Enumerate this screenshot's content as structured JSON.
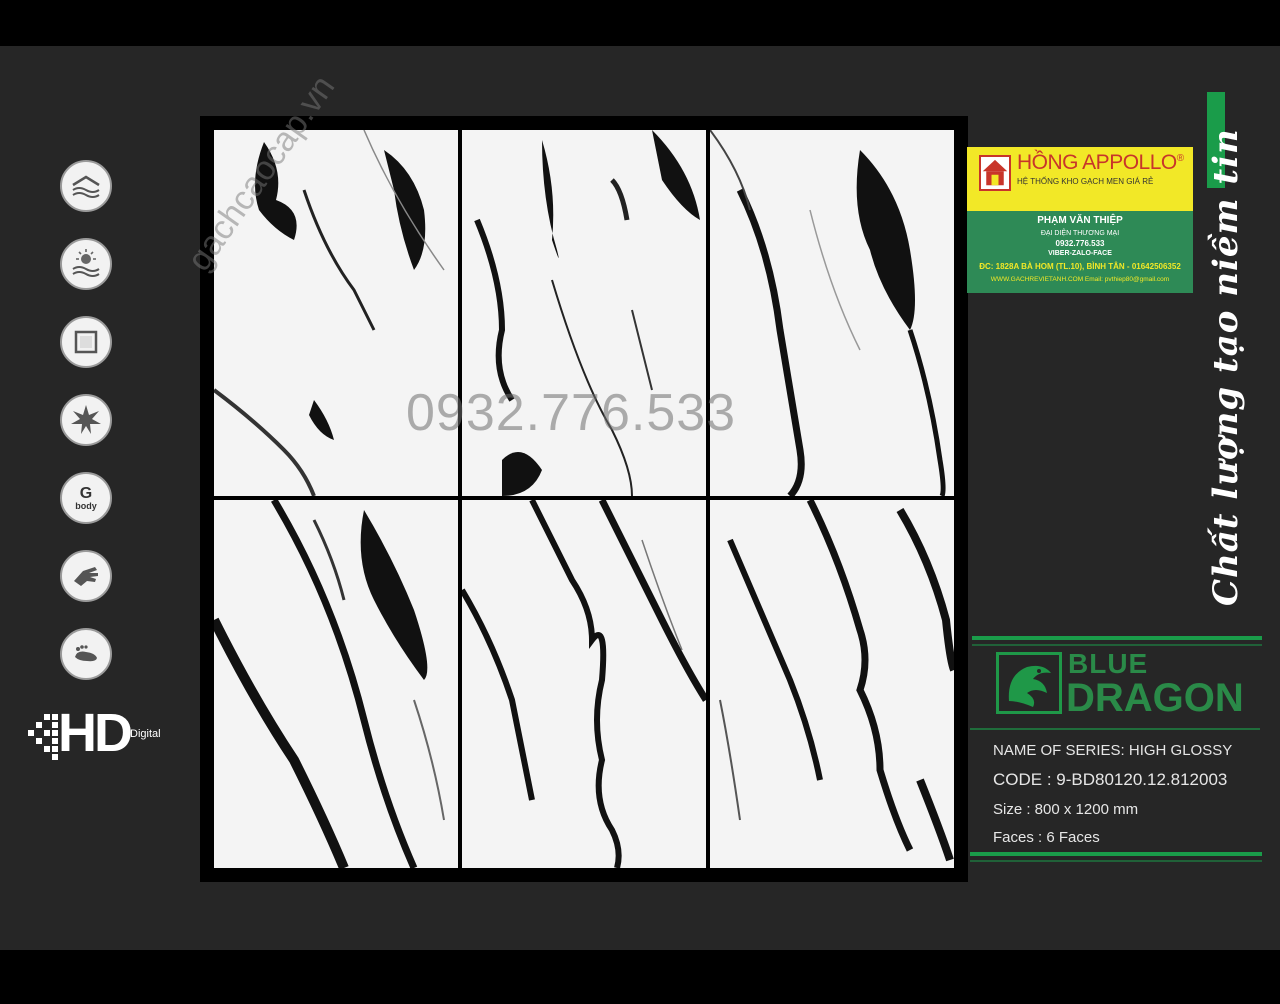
{
  "features": {
    "icons": [
      "wave-roof-icon",
      "sun-water-icon",
      "square-edge-icon",
      "starburst-icon",
      "g-body-icon",
      "hand-icon",
      "foot-icon"
    ],
    "g_body_letter": "G",
    "g_body_word": "body"
  },
  "hd": {
    "big": "HD",
    "small": "Digital"
  },
  "watermark": {
    "phone": "0932.776.533",
    "site": "gachcaocap.vn"
  },
  "card": {
    "brand": "HỒNG APPOLLO",
    "reg": "®",
    "tagline": "HỆ THỐNG KHO GẠCH MEN GIÁ RẺ",
    "name": "PHẠM VĂN THIỆP",
    "role": "ĐẠI DIỆN THƯƠNG MẠI",
    "phone": "0932.776.533",
    "contact": "VIBER-ZALO-FACE",
    "address": "ĐC: 1828A BÀ HOM (TL.10), BÌNH TÂN - 01642506352",
    "web": "WWW.GACHREVIETANH.COM  Email: pvthiep80@gmail.com"
  },
  "slogan": "Chất lượng tạo niềm tin",
  "brand": {
    "line1": "BLUE",
    "line2": "DRAGON"
  },
  "specs": {
    "series": "NAME OF SERIES:  HIGH GLOSSY",
    "code": "CODE  :  9-BD80120.12.812003",
    "size": "Size     :  800 x 1200 mm",
    "faces": "Faces  :  6 Faces"
  },
  "colors": {
    "background": "#262626",
    "accent_green": "#1a9c4a",
    "card_yellow": "#f2e827",
    "card_green": "#2e8a56",
    "brand_red": "#c8352a"
  }
}
